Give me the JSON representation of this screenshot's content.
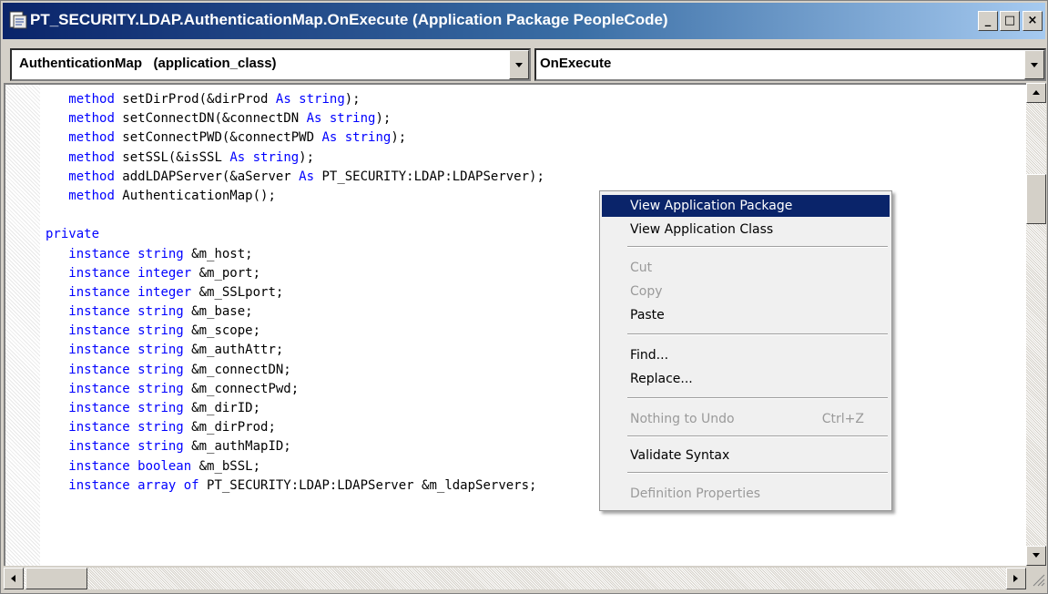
{
  "window": {
    "title": "PT_SECURITY.LDAP.AuthenticationMap.OnExecute (Application Package PeopleCode)",
    "minimize_glyph": "_",
    "maximize_glyph": "□",
    "close_glyph": "×"
  },
  "object_combo": {
    "value": "AuthenticationMap   (application_class)"
  },
  "event_combo": {
    "value": "OnExecute"
  },
  "code_lines": [
    {
      "indent": "   ",
      "kw": "method",
      "rest": " setDirProd(&dirProd ",
      "kw2": "As string",
      "tail": ");"
    },
    {
      "indent": "   ",
      "kw": "method",
      "rest": " setConnectDN(&connectDN ",
      "kw2": "As string",
      "tail": ");"
    },
    {
      "indent": "   ",
      "kw": "method",
      "rest": " setConnectPWD(&connectPWD ",
      "kw2": "As string",
      "tail": ");"
    },
    {
      "indent": "   ",
      "kw": "method",
      "rest": " setSSL(&isSSL ",
      "kw2": "As string",
      "tail": ");"
    },
    {
      "indent": "   ",
      "kw": "method",
      "rest": " addLDAPServer(&aServer ",
      "kw2": "As",
      "tail": " PT_SECURITY:LDAP:LDAPServer);"
    },
    {
      "indent": "   ",
      "kw": "method",
      "rest": " AuthenticationMap();",
      "kw2": "",
      "tail": ""
    },
    {
      "indent": "",
      "kw": "",
      "rest": "",
      "kw2": "",
      "tail": ""
    },
    {
      "indent": "",
      "kw": "private",
      "rest": "",
      "kw2": "",
      "tail": ""
    },
    {
      "indent": "   ",
      "kw": "instance string",
      "rest": " &m_host;",
      "kw2": "",
      "tail": ""
    },
    {
      "indent": "   ",
      "kw": "instance integer",
      "rest": " &m_port;",
      "kw2": "",
      "tail": ""
    },
    {
      "indent": "   ",
      "kw": "instance integer",
      "rest": " &m_SSLport;",
      "kw2": "",
      "tail": ""
    },
    {
      "indent": "   ",
      "kw": "instance string",
      "rest": " &m_base;",
      "kw2": "",
      "tail": ""
    },
    {
      "indent": "   ",
      "kw": "instance string",
      "rest": " &m_scope;",
      "kw2": "",
      "tail": ""
    },
    {
      "indent": "   ",
      "kw": "instance string",
      "rest": " &m_authAttr;",
      "kw2": "",
      "tail": ""
    },
    {
      "indent": "   ",
      "kw": "instance string",
      "rest": " &m_connectDN;",
      "kw2": "",
      "tail": ""
    },
    {
      "indent": "   ",
      "kw": "instance string",
      "rest": " &m_connectPwd;",
      "kw2": "",
      "tail": ""
    },
    {
      "indent": "   ",
      "kw": "instance string",
      "rest": " &m_dirID;",
      "kw2": "",
      "tail": ""
    },
    {
      "indent": "   ",
      "kw": "instance string",
      "rest": " &m_dirProd;",
      "kw2": "",
      "tail": ""
    },
    {
      "indent": "   ",
      "kw": "instance string",
      "rest": " &m_authMapID;",
      "kw2": "",
      "tail": ""
    },
    {
      "indent": "   ",
      "kw": "instance boolean",
      "rest": " &m_bSSL;",
      "kw2": "",
      "tail": ""
    },
    {
      "indent": "   ",
      "kw": "instance array of",
      "rest": " PT_SECURITY:LDAP:LDAPServer &m_ldapServers;",
      "kw2": "",
      "tail": ""
    }
  ],
  "context_menu": {
    "items": [
      {
        "label": "View Application Package",
        "enabled": true,
        "selected": true,
        "shortcut": ""
      },
      {
        "label": "View Application Class",
        "enabled": true,
        "selected": false,
        "shortcut": ""
      },
      {
        "label": "Cut",
        "enabled": false,
        "selected": false,
        "shortcut": ""
      },
      {
        "label": "Copy",
        "enabled": false,
        "selected": false,
        "shortcut": ""
      },
      {
        "label": "Paste",
        "enabled": true,
        "selected": false,
        "shortcut": ""
      },
      {
        "label": "Find...",
        "enabled": true,
        "selected": false,
        "shortcut": ""
      },
      {
        "label": "Replace...",
        "enabled": true,
        "selected": false,
        "shortcut": ""
      },
      {
        "label": "Nothing to Undo",
        "enabled": false,
        "selected": false,
        "shortcut": "Ctrl+Z"
      },
      {
        "label": "Validate Syntax",
        "enabled": true,
        "selected": false,
        "shortcut": ""
      },
      {
        "label": "Definition Properties",
        "enabled": false,
        "selected": false,
        "shortcut": ""
      }
    ]
  },
  "colors": {
    "keyword": "#0000ff",
    "selection": "#0a246a",
    "disabled_text": "#9a9a9a"
  },
  "icons": {
    "title": "peoplecode-document-icon",
    "combo_arrow": "chevron-down-icon",
    "scroll_up": "arrow-up-icon",
    "scroll_down": "arrow-down-icon",
    "scroll_left": "arrow-left-icon",
    "scroll_right": "arrow-right-icon"
  }
}
